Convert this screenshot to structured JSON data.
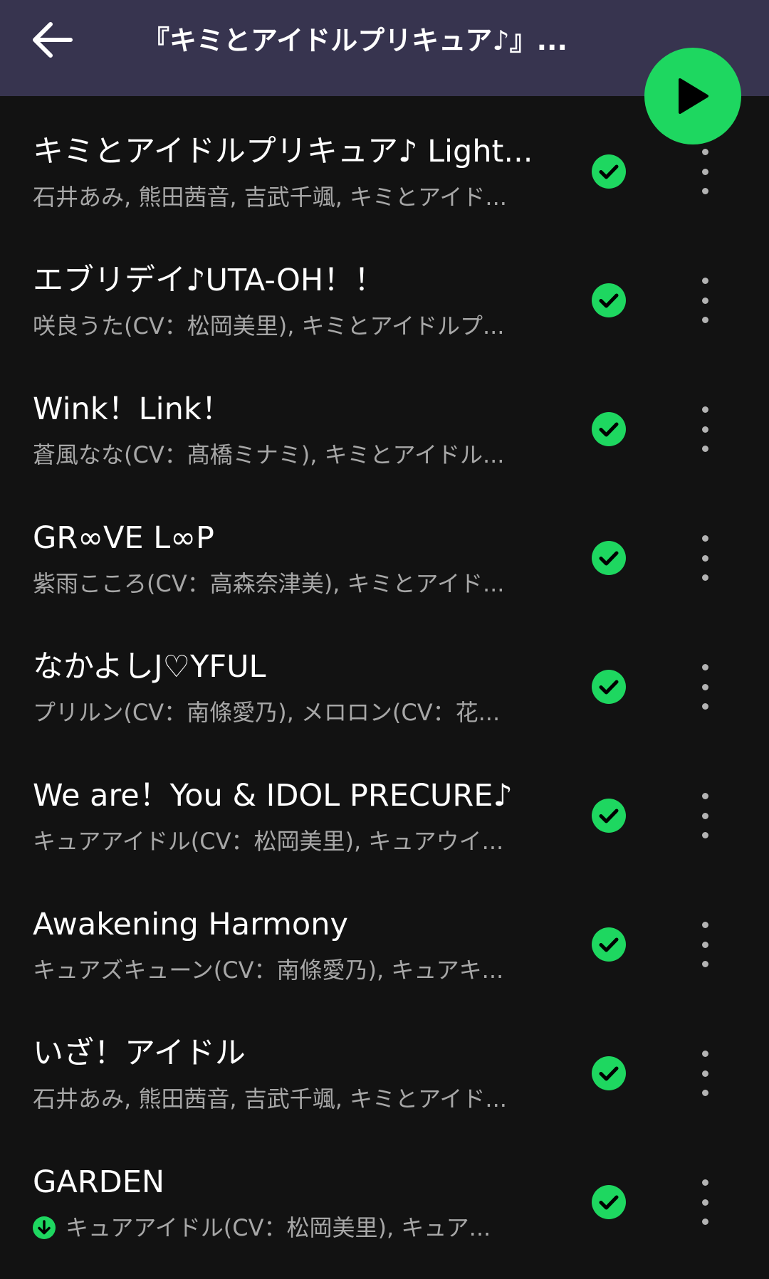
{
  "header": {
    "title": "『キミとアイドルプリキュア♪』...",
    "back_icon": "arrow-left-icon",
    "play_icon": "play-icon"
  },
  "colors": {
    "header_bg": "#37344f",
    "background": "#121212",
    "accent": "#1ed760",
    "subtext": "#a7a7a7"
  },
  "tracks": [
    {
      "title": "キミとアイドルプリキュア♪ Light...",
      "artist": "石井あみ, 熊田茜音, 吉武千颯, キミとアイド...",
      "downloaded": true
    },
    {
      "title": "エブリデイ♪UTA-OH！！",
      "artist": "咲良うた(CV：松岡美里), キミとアイドルプ...",
      "downloaded": true
    },
    {
      "title": "Wink！Link！",
      "artist": "蒼風なな(CV：髙橋ミナミ), キミとアイドル...",
      "downloaded": true
    },
    {
      "title": "GR∞VE L∞P",
      "artist": "紫雨こころ(CV：高森奈津美), キミとアイド...",
      "downloaded": true
    },
    {
      "title": "なかよしJ♡YFUL",
      "artist": "プリルン(CV：南條愛乃), メロロン(CV：花...",
      "downloaded": true
    },
    {
      "title": "We are！You & IDOL PRECURE♪",
      "artist": "キュアアイドル(CV：松岡美里), キュアウイ...",
      "downloaded": true
    },
    {
      "title": "Awakening Harmony",
      "artist": "キュアズキューン(CV：南條愛乃), キュアキ...",
      "downloaded": true
    },
    {
      "title": "いざ！アイドル",
      "artist": "石井あみ, 熊田茜音, 吉武千颯, キミとアイド...",
      "downloaded": true
    },
    {
      "title": "GARDEN",
      "artist": "キュアアイドル(CV：松岡美里), キュア...",
      "downloaded": true,
      "downloading": true
    }
  ]
}
